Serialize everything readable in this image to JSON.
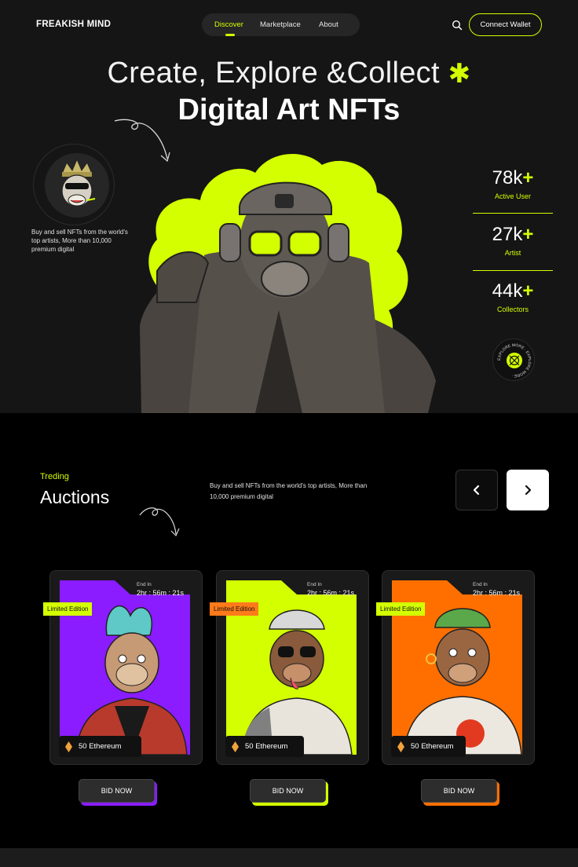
{
  "nav": {
    "logo": "FREAKISH MIND",
    "links": [
      "Discover",
      "Marketplace",
      "About"
    ],
    "active": "Discover",
    "connect_label": "Connect Wallet",
    "search_icon": "search-icon"
  },
  "hero": {
    "line1": "Create, Explore &Collect",
    "line2": "Digital Art NFTs",
    "description": "Buy and sell NFTs from the world's top artists, More than 10,000 premium digital",
    "stats": [
      {
        "value": "78k",
        "suffix": "+",
        "label": "Active User"
      },
      {
        "value": "27k",
        "suffix": "+",
        "label": "Artist"
      },
      {
        "value": "44k",
        "suffix": "+",
        "label": "Collectors"
      }
    ],
    "badge_text": "EXPLORE MORE · EXPLORE MORE ·"
  },
  "auctions": {
    "kicker": "Treding",
    "title": "Auctions",
    "description": "Buy and sell NFTs from the world's top artists, More than 10,000 premium digital",
    "cards": [
      {
        "ends_label": "End In",
        "ends_time": "2hr : 56m : 21s",
        "edition": "Limited Edition",
        "price": "50 Ethereum",
        "bid": "BID NOW",
        "color": "#8a1cff",
        "tag_color": "#d4ff00"
      },
      {
        "ends_label": "End In",
        "ends_time": "2hr : 56m : 21s",
        "edition": "Limited Edition",
        "price": "50 Ethereum",
        "bid": "BID NOW",
        "color": "#d4ff00",
        "tag_color": "#ff7a1a"
      },
      {
        "ends_label": "End In",
        "ends_time": "2hr : 56m : 21s",
        "edition": "Limited Edition",
        "price": "50 Ethereum",
        "bid": "BID NOW",
        "color": "#ff6f00",
        "tag_color": "#d4ff00"
      }
    ]
  },
  "colors": {
    "accent": "#d4ff00",
    "background": "#151515"
  }
}
